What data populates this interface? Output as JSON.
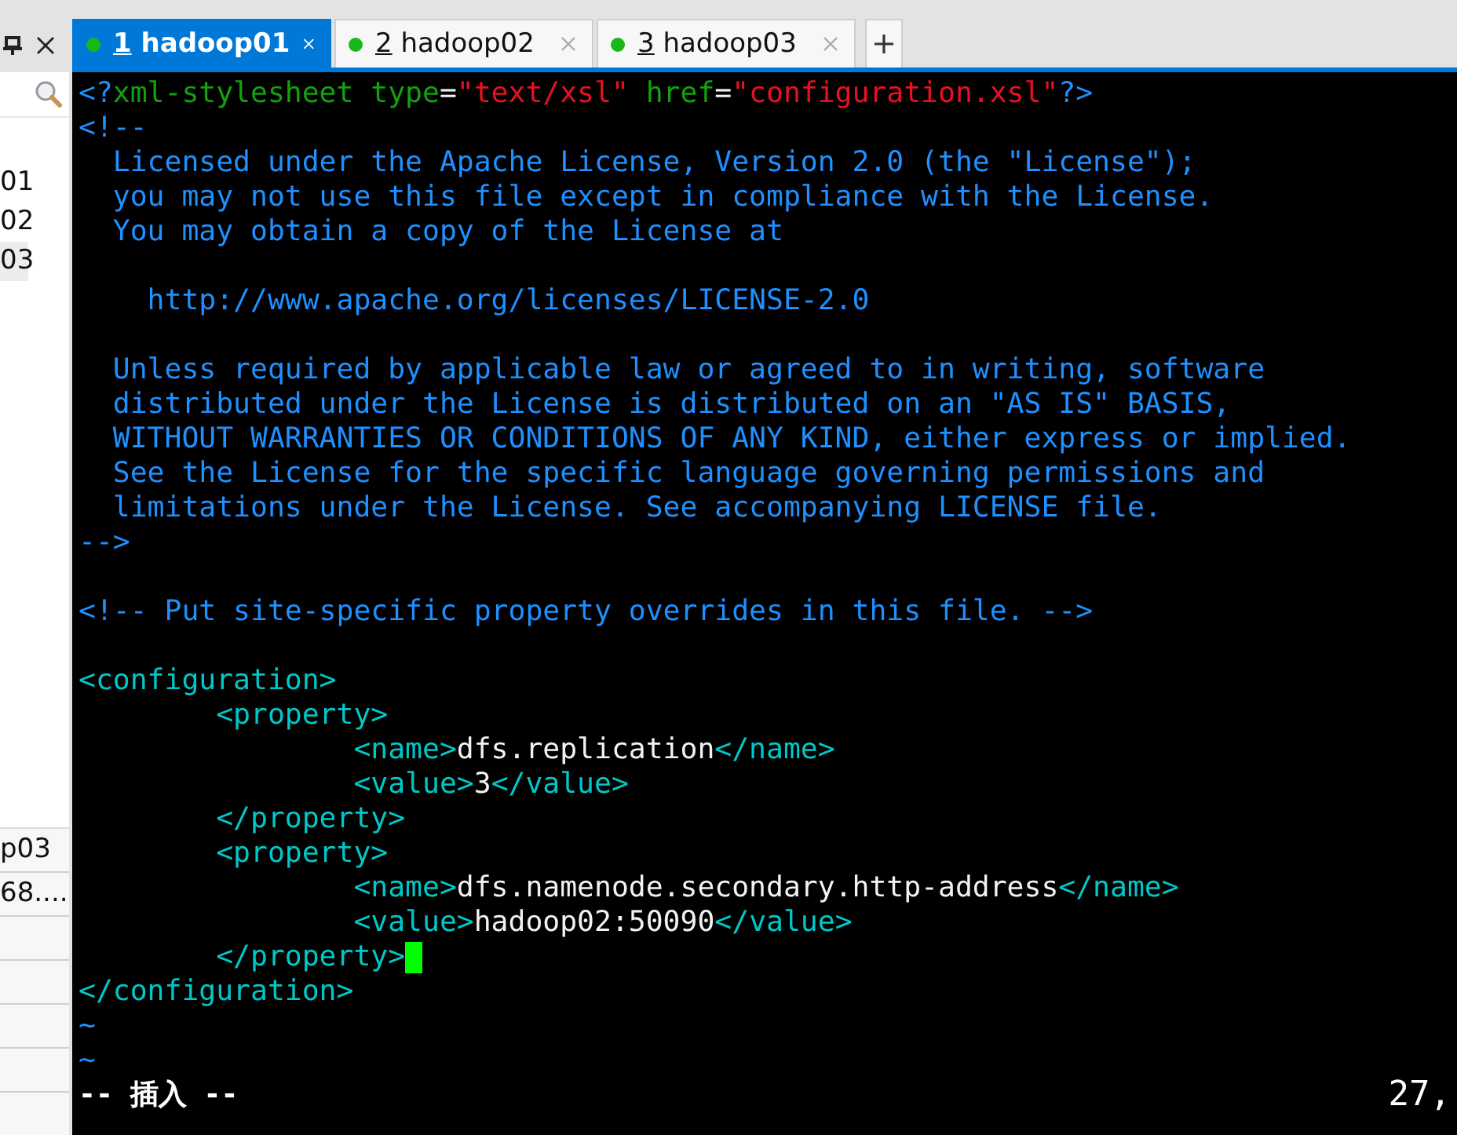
{
  "sidebar": {
    "items": [
      {
        "label": "01",
        "selected": false
      },
      {
        "label": "02",
        "selected": false
      },
      {
        "label": "03",
        "selected": true
      }
    ],
    "details": [
      "p03",
      "68...."
    ]
  },
  "tabs": [
    {
      "key": "1",
      "label": "hadoop01",
      "selected": true
    },
    {
      "key": "2",
      "label": "hadoop02",
      "selected": false
    },
    {
      "key": "3",
      "label": "hadoop03",
      "selected": false
    }
  ],
  "terminal": {
    "lines": [
      {
        "kind": "code",
        "segments": [
          {
            "kind": "punct",
            "text": "<?"
          },
          {
            "kind": "keyword",
            "text": "xml-stylesheet type"
          },
          {
            "kind": "op",
            "text": "="
          },
          {
            "kind": "string",
            "text": "\"text/xsl\""
          },
          {
            "kind": "keyword",
            "text": " href"
          },
          {
            "kind": "op",
            "text": "="
          },
          {
            "kind": "string",
            "text": "\"configuration.xsl\""
          },
          {
            "kind": "punct",
            "text": "?>"
          }
        ]
      },
      {
        "kind": "code",
        "segments": [
          {
            "kind": "comment",
            "text": "<!--"
          }
        ]
      },
      {
        "kind": "code",
        "segments": [
          {
            "kind": "comment",
            "text": "  Licensed under the Apache License, Version 2.0 (the \"License\");"
          }
        ]
      },
      {
        "kind": "code",
        "segments": [
          {
            "kind": "comment",
            "text": "  you may not use this file except in compliance with the License."
          }
        ]
      },
      {
        "kind": "code",
        "segments": [
          {
            "kind": "comment",
            "text": "  You may obtain a copy of the License at"
          }
        ]
      },
      {
        "kind": "blank"
      },
      {
        "kind": "code",
        "segments": [
          {
            "kind": "comment",
            "text": "    http://www.apache.org/licenses/LICENSE-2.0"
          }
        ]
      },
      {
        "kind": "blank"
      },
      {
        "kind": "code",
        "segments": [
          {
            "kind": "comment",
            "text": "  Unless required by applicable law or agreed to in writing, software"
          }
        ]
      },
      {
        "kind": "code",
        "segments": [
          {
            "kind": "comment",
            "text": "  distributed under the License is distributed on an \"AS IS\" BASIS,"
          }
        ]
      },
      {
        "kind": "code",
        "segments": [
          {
            "kind": "comment",
            "text": "  WITHOUT WARRANTIES OR CONDITIONS OF ANY KIND, either express or implied."
          }
        ]
      },
      {
        "kind": "code",
        "segments": [
          {
            "kind": "comment",
            "text": "  See the License for the specific language governing permissions and"
          }
        ]
      },
      {
        "kind": "code",
        "segments": [
          {
            "kind": "comment",
            "text": "  limitations under the License. See accompanying LICENSE file."
          }
        ]
      },
      {
        "kind": "code",
        "segments": [
          {
            "kind": "comment",
            "text": "-->"
          }
        ]
      },
      {
        "kind": "blank"
      },
      {
        "kind": "code",
        "segments": [
          {
            "kind": "comment",
            "text": "<!-- Put site-specific property overrides in this file. -->"
          }
        ]
      },
      {
        "kind": "blank"
      },
      {
        "kind": "code",
        "segments": [
          {
            "kind": "tag",
            "text": "<configuration>"
          }
        ]
      },
      {
        "kind": "code",
        "segments": [
          {
            "kind": "tag",
            "text": "        <property>"
          }
        ]
      },
      {
        "kind": "code",
        "segments": [
          {
            "kind": "tag",
            "text": "                <name>"
          },
          {
            "kind": "text",
            "text": "dfs.replication"
          },
          {
            "kind": "tag",
            "text": "</name>"
          }
        ]
      },
      {
        "kind": "code",
        "segments": [
          {
            "kind": "tag",
            "text": "                <value>"
          },
          {
            "kind": "text",
            "text": "3"
          },
          {
            "kind": "tag",
            "text": "</value>"
          }
        ]
      },
      {
        "kind": "code",
        "segments": [
          {
            "kind": "tag",
            "text": "        </property>"
          }
        ]
      },
      {
        "kind": "code",
        "segments": [
          {
            "kind": "tag",
            "text": "        <property>"
          }
        ]
      },
      {
        "kind": "code",
        "segments": [
          {
            "kind": "tag",
            "text": "                <name>"
          },
          {
            "kind": "text",
            "text": "dfs.namenode.secondary.http-address"
          },
          {
            "kind": "tag",
            "text": "</name>"
          }
        ]
      },
      {
        "kind": "code",
        "segments": [
          {
            "kind": "tag",
            "text": "                <value>"
          },
          {
            "kind": "text",
            "text": "hadoop02:50090"
          },
          {
            "kind": "tag",
            "text": "</value>"
          }
        ]
      },
      {
        "kind": "code",
        "cursor": true,
        "segments": [
          {
            "kind": "tag",
            "text": "        </property>"
          }
        ]
      },
      {
        "kind": "code",
        "segments": [
          {
            "kind": "tag",
            "text": "</configuration>"
          }
        ]
      },
      {
        "kind": "tilde",
        "segments": [
          {
            "kind": "punct",
            "text": "~"
          }
        ]
      },
      {
        "kind": "tilde",
        "segments": [
          {
            "kind": "punct",
            "text": "~"
          }
        ]
      }
    ],
    "mode": "-- 插入 --",
    "ruler": "27,"
  }
}
